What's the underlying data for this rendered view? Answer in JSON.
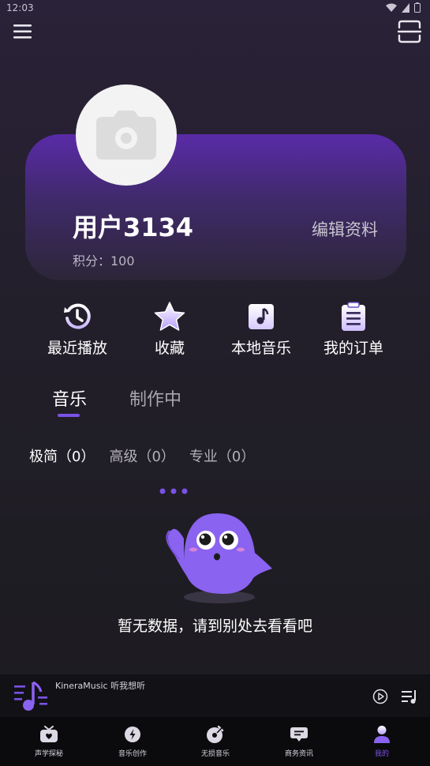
{
  "status_bar": {
    "time": "12:03"
  },
  "profile": {
    "username": "用户3134",
    "edit_label": "编辑资料",
    "points": "积分：100"
  },
  "quick_actions": [
    {
      "label": "最近播放",
      "icon": "history-icon"
    },
    {
      "label": "收藏",
      "icon": "star-icon"
    },
    {
      "label": "本地音乐",
      "icon": "music-note-icon"
    },
    {
      "label": "我的订单",
      "icon": "clipboard-icon"
    }
  ],
  "tabs": [
    {
      "label": "音乐",
      "active": true
    },
    {
      "label": "制作中",
      "active": false
    }
  ],
  "filters": [
    {
      "label": "极简（0）",
      "active": true
    },
    {
      "label": "高级（0）",
      "active": false
    },
    {
      "label": "专业（0）",
      "active": false
    }
  ],
  "empty_state": {
    "message": "暂无数据，请到别处去看看吧"
  },
  "mini_player": {
    "title": "KineraMusic 听我想听"
  },
  "bottom_nav": [
    {
      "label": "声学探秘",
      "icon": "tv-icon",
      "active": false
    },
    {
      "label": "音乐创作",
      "icon": "lightning-icon",
      "active": false
    },
    {
      "label": "无损音乐",
      "icon": "vinyl-icon",
      "active": false
    },
    {
      "label": "商务资讯",
      "icon": "chat-icon",
      "active": false
    },
    {
      "label": "我的",
      "icon": "user-icon",
      "active": true
    }
  ],
  "colors": {
    "accent": "#7a52e6",
    "card_top": "#5a2ba8",
    "background": "#1f1d24"
  }
}
